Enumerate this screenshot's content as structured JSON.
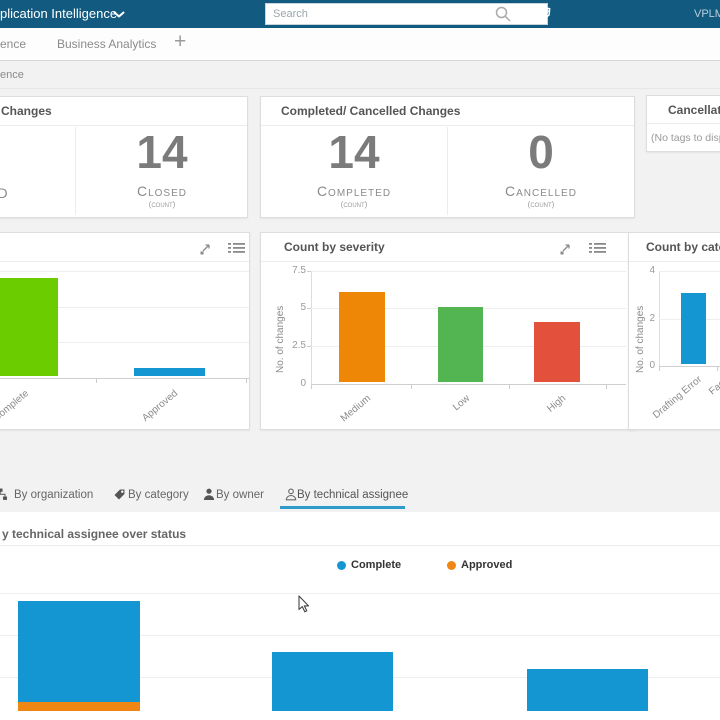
{
  "colors": {
    "topbar_bg": "#125A80",
    "page_bg": "#F2F2F2",
    "accent_blue": "#1496D2",
    "lime_green": "#6BCC00",
    "green": "#53B552",
    "orange": "#EE8705",
    "orange_approved": "#F08613",
    "red": "#E3503C",
    "tab_underline": "#2E9BC9"
  },
  "topbar": {
    "title": "plication Intelligence",
    "search_placeholder": "Search",
    "user": "VPLM"
  },
  "tabbar": {
    "left_tab": "ence",
    "active_tab": "Business Analytics",
    "add_button": "+"
  },
  "breadcrumb": {
    "label": "ence"
  },
  "kpis": {
    "changes": {
      "title": "Changes",
      "partial_metric_label": "D",
      "closed_value": "14",
      "closed_label": "Closed",
      "closed_sub": "(count)"
    },
    "completed_cancelled": {
      "title": "Completed/ Cancelled Changes",
      "completed_value": "14",
      "completed_label": "Completed",
      "completed_sub": "(count)",
      "cancelled_value": "0",
      "cancelled_label": "Cancelled",
      "cancelled_sub": "(count)"
    },
    "cancellation": {
      "title": "Cancellation",
      "empty_text": "(No tags to display)"
    }
  },
  "chart_data": [
    {
      "id": "count-by-status",
      "type": "bar",
      "title": "",
      "categories": [
        "Complete",
        "Approved"
      ],
      "values": [
        13,
        1
      ],
      "bar_colors": [
        "#6BCC00",
        "#1496D2"
      ],
      "yticks_visible": false,
      "axis_clipped": true
    },
    {
      "id": "count-by-severity",
      "type": "bar",
      "title": "Count by severity",
      "categories": [
        "Medium",
        "Low",
        "High"
      ],
      "values": [
        6,
        5,
        4
      ],
      "bar_colors": [
        "#EE8705",
        "#53B552",
        "#E3503C"
      ],
      "ylabel": "No. of changes",
      "yticks": [
        "0",
        "2.5",
        "5",
        "7.5"
      ],
      "ylim": [
        0,
        7.5
      ],
      "grid": true
    },
    {
      "id": "count-by-category",
      "type": "bar",
      "title": "Count by category",
      "categories": [
        "Drafting Error",
        "Facili"
      ],
      "values": [
        3,
        null
      ],
      "bar_colors": [
        "#1496D2"
      ],
      "ylabel": "No. of changes",
      "yticks": [
        "0",
        "2",
        "4"
      ],
      "ylim": [
        0,
        4
      ],
      "grid": true
    },
    {
      "id": "count-by-technical-assignee-over-status",
      "type": "stacked-bar",
      "title": "y technical assignee over status",
      "categories": [
        "",
        "",
        ""
      ],
      "series": [
        {
          "name": "Complete",
          "color": "#1496D2",
          "values": [
            6,
            4,
            3
          ]
        },
        {
          "name": "Approved",
          "color": "#F08613",
          "values": [
            1,
            0,
            0
          ]
        }
      ],
      "legend_position": "top",
      "yticks_visible": false,
      "grid": true
    }
  ],
  "filter_tabs": {
    "items": [
      {
        "label": "By organization",
        "icon": "organization-icon"
      },
      {
        "label": "By category",
        "icon": "tag-icon"
      },
      {
        "label": "By owner",
        "icon": "person-icon"
      },
      {
        "label": "By technical assignee",
        "icon": "person-outline-icon"
      }
    ],
    "active_index": 3
  },
  "assignee_section": {
    "title": "y technical assignee over status",
    "legend": [
      {
        "label": "Complete",
        "color": "#1496D2"
      },
      {
        "label": "Approved",
        "color": "#F08613"
      }
    ]
  }
}
